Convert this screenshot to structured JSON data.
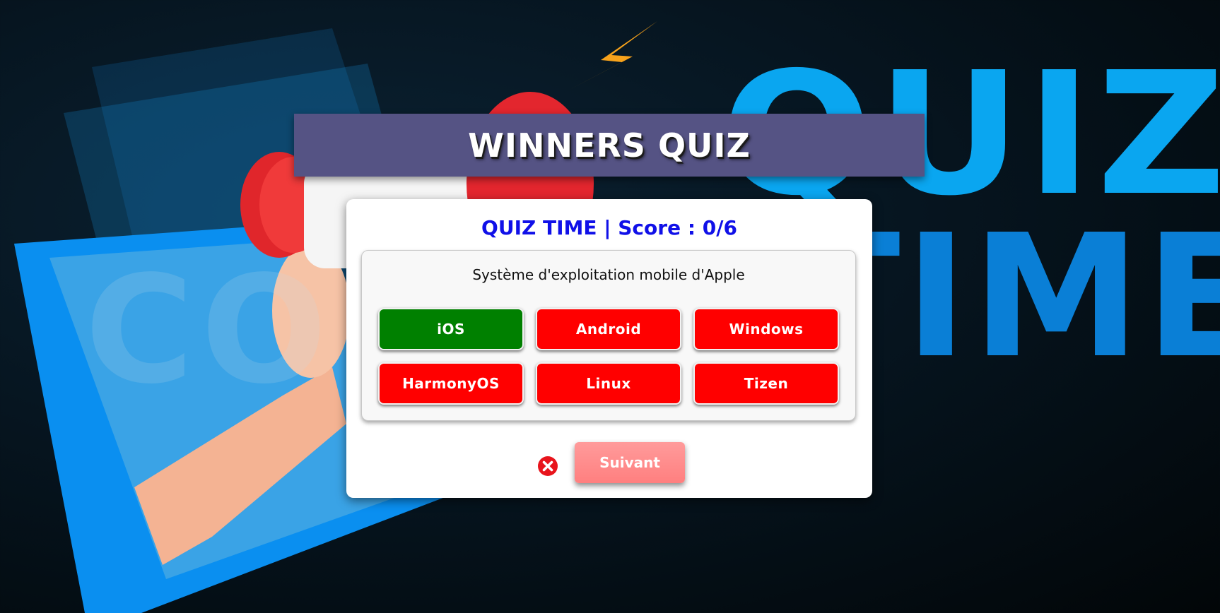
{
  "app": {
    "title": "WINNERS QUIZ"
  },
  "background": {
    "headline_line1": "QUIZ",
    "headline_line2": "TIME",
    "watermark": "CODE"
  },
  "quiz": {
    "header": "QUIZ TIME | Score : 0/6",
    "question": "Système d'exploitation mobile d'Apple",
    "answers": [
      {
        "label": "iOS",
        "state": "correct"
      },
      {
        "label": "Android",
        "state": "wrong"
      },
      {
        "label": "Windows",
        "state": "wrong"
      },
      {
        "label": "HarmonyOS",
        "state": "wrong"
      },
      {
        "label": "Linux",
        "state": "wrong"
      },
      {
        "label": "Tizen",
        "state": "wrong"
      }
    ],
    "result_icon": "wrong-answer-icon",
    "next_label": "Suivant"
  },
  "colors": {
    "banner": "#555384",
    "header_text": "#1010e8",
    "correct": "#008000",
    "wrong": "#ff0000",
    "next_button": "#ff8a8a"
  }
}
